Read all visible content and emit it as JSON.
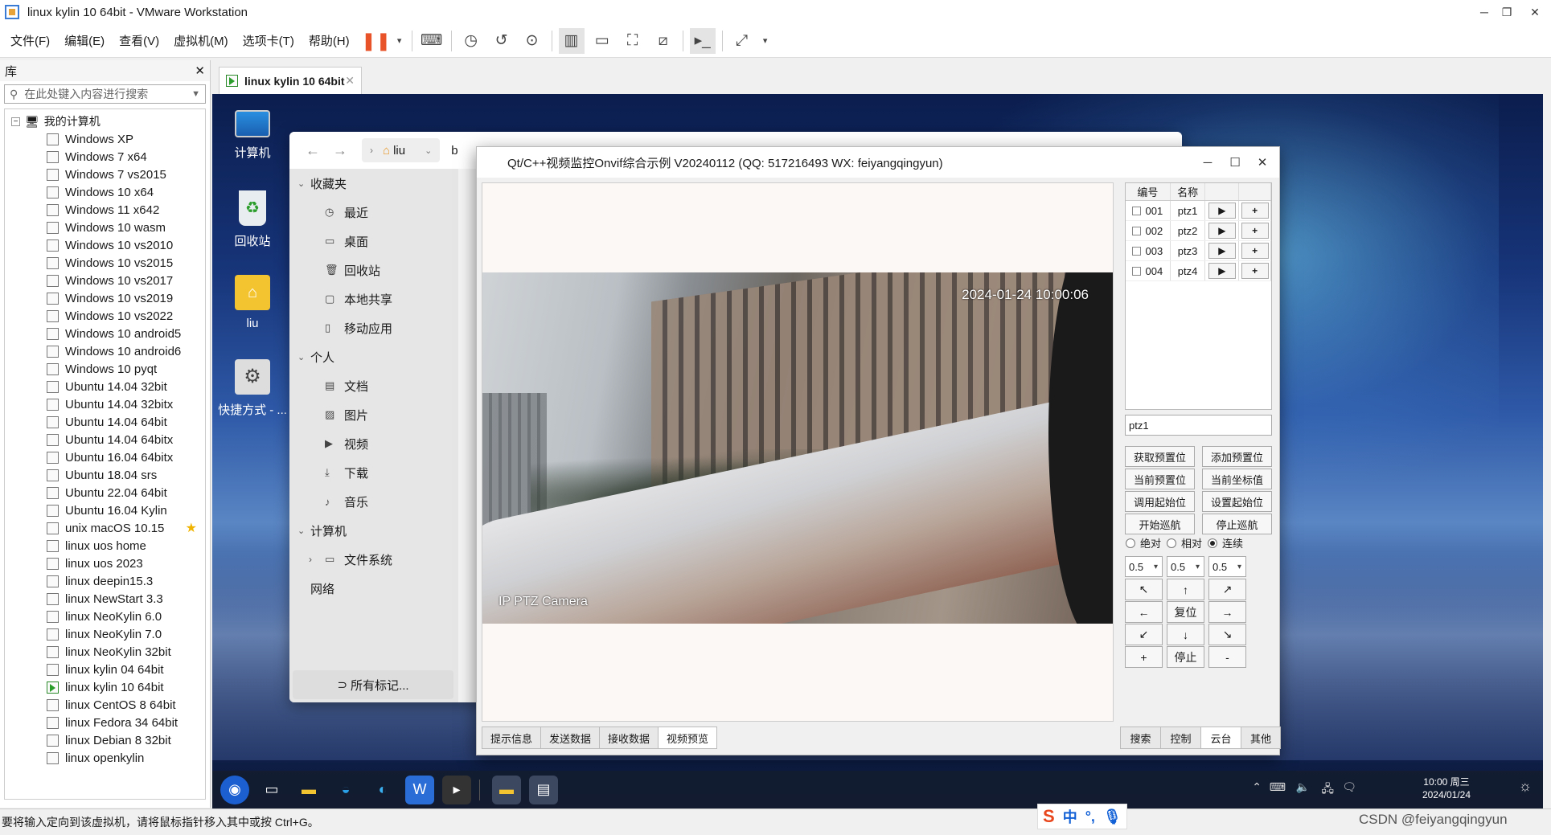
{
  "window": {
    "title": "linux kylin 10 64bit - VMware Workstation"
  },
  "menu": [
    "文件(F)",
    "编辑(E)",
    "查看(V)",
    "虚拟机(M)",
    "选项卡(T)",
    "帮助(H)"
  ],
  "library": {
    "title": "库",
    "search_placeholder": "在此处键入内容进行搜索",
    "root": "我的计算机",
    "items": [
      "Windows XP",
      "Windows 7 x64",
      "Windows 7 vs2015",
      "Windows 10 x64",
      "Windows 11 x642",
      "Windows 10 wasm",
      "Windows 10 vs2010",
      "Windows 10 vs2015",
      "Windows 10 vs2017",
      "Windows 10 vs2019",
      "Windows 10 vs2022",
      "Windows 10 android5",
      "Windows 10 android6",
      "Windows 10 pyqt",
      "Ubuntu 14.04 32bit",
      "Ubuntu 14.04 32bitx",
      "Ubuntu 14.04 64bit",
      "Ubuntu 14.04 64bitx",
      "Ubuntu 16.04 64bitx",
      "Ubuntu 18.04 srs",
      "Ubuntu 22.04 64bit",
      "Ubuntu 16.04 Kylin",
      "unix macOS 10.15",
      "linux uos home",
      "linux uos 2023",
      "linux deepin15.3",
      "linux NewStart 3.3",
      "linux NeoKylin 6.0",
      "linux NeoKylin 7.0",
      "linux NeoKylin 32bit",
      "linux kylin 04 64bit",
      "linux kylin 10 64bit",
      "linux CentOS 8 64bit",
      "linux Fedora 34 64bit",
      "linux Debian 8 32bit",
      "linux openkylin"
    ],
    "active_item": "linux kylin 10 64bit",
    "starred_item": "unix macOS 10.15"
  },
  "vm_tab": {
    "label": "linux kylin 10 64bit"
  },
  "desktop_icons": [
    "计算机",
    "回收站",
    "liu",
    "快捷方式 - ..."
  ],
  "file_manager": {
    "crumb": "liu",
    "crumb_next": "b",
    "sections": [
      {
        "title": "收藏夹",
        "items": [
          "最近",
          "桌面",
          "回收站",
          "本地共享",
          "移动应用"
        ]
      },
      {
        "title": "个人",
        "items": [
          "文档",
          "图片",
          "视频",
          "下载",
          "音乐"
        ]
      },
      {
        "title": "计算机",
        "items": [
          "文件系统"
        ]
      },
      {
        "title": "网络",
        "items": []
      }
    ],
    "bottom_button": "所有标记..."
  },
  "qt_app": {
    "title": "Qt/C++视频监控Onvif综合示例 V20240112 (QQ: 517216493 WX: feiyangqingyun)",
    "video": {
      "timestamp": "2024-01-24 10:00:06",
      "camera_label": "IP PTZ Camera"
    },
    "bottom_tabs": [
      "提示信息",
      "发送数据",
      "接收数据",
      "视频预览"
    ],
    "selected_bottom_tab": "视频预览",
    "ptz_table": {
      "headers": [
        "编号",
        "名称"
      ],
      "rows": [
        {
          "id": "001",
          "name": "ptz1"
        },
        {
          "id": "002",
          "name": "ptz2"
        },
        {
          "id": "003",
          "name": "ptz3"
        },
        {
          "id": "004",
          "name": "ptz4"
        }
      ],
      "play_glyph": "▶",
      "add_glyph": "+"
    },
    "ptz_input": "ptz1",
    "buttons": [
      "获取预置位",
      "添加预置位",
      "当前预置位",
      "当前坐标值",
      "调用起始位",
      "设置起始位",
      "开始巡航",
      "停止巡航"
    ],
    "radios": [
      {
        "label": "绝对",
        "checked": false
      },
      {
        "label": "相对",
        "checked": false
      },
      {
        "label": "连续",
        "checked": true
      }
    ],
    "speeds": [
      "0.5",
      "0.5",
      "0.5"
    ],
    "dirpad": [
      "↖",
      "↑",
      "↗",
      "←",
      "复位",
      "→",
      "↙",
      "↓",
      "↘",
      "+",
      "停止",
      "-"
    ],
    "right_tabs": [
      "搜索",
      "控制",
      "云台",
      "其他"
    ],
    "selected_right_tab": "云台"
  },
  "taskbar": {
    "time": "10:00 周三",
    "date": "2024/01/24"
  },
  "status": {
    "text": "要将输入定向到该虚拟机，请将鼠标指针移入其中或按 Ctrl+G。"
  },
  "ime": {
    "label": "中"
  },
  "watermark": "CSDN @feiyangqingyun"
}
